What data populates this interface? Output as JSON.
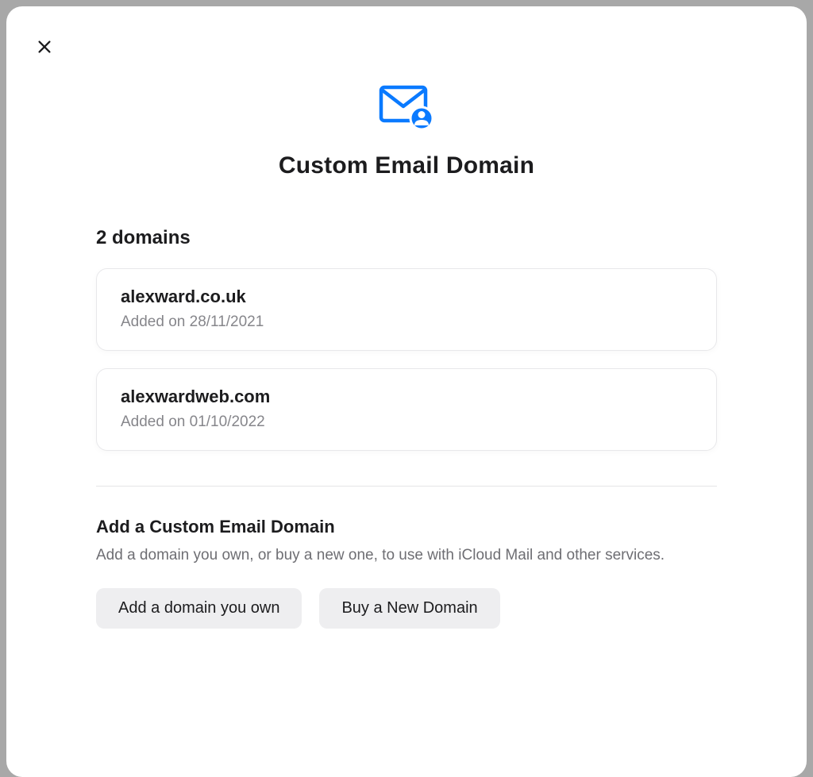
{
  "title": "Custom Email Domain",
  "domainCount": "2 domains",
  "domains": [
    {
      "name": "alexward.co.uk",
      "added": "Added on 28/11/2021"
    },
    {
      "name": "alexwardweb.com",
      "added": "Added on 01/10/2022"
    }
  ],
  "addSection": {
    "title": "Add a Custom Email Domain",
    "description": "Add a domain you own, or buy a new one, to use with iCloud Mail and other services.",
    "ownButton": "Add a domain you own",
    "buyButton": "Buy a New Domain"
  }
}
